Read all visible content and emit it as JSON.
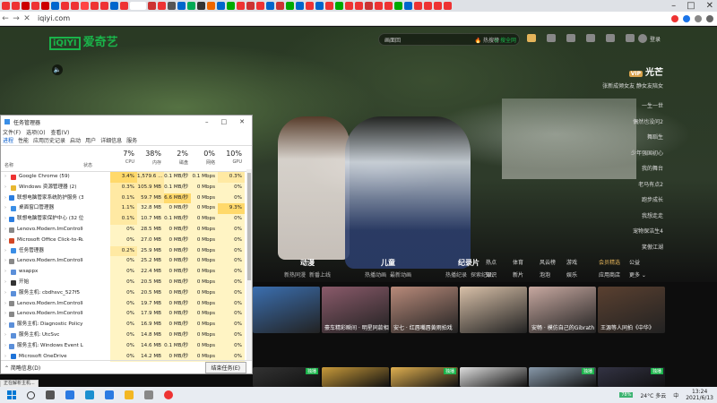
{
  "browser": {
    "url": "iqiyi.com",
    "tab_colors": [
      "#e33",
      "#e33",
      "#c00",
      "#e33",
      "#c00",
      "#06c",
      "#e33",
      "#e33",
      "#f44",
      "#e33",
      "#e33",
      "#06c",
      "#e33",
      "#fff",
      "#c33",
      "#e33",
      "#555",
      "#06c",
      "#0a5",
      "#333",
      "#e60",
      "#06c",
      "#0a0",
      "#e33",
      "#c33",
      "#e33",
      "#06c",
      "#c33",
      "#0a0",
      "#06c",
      "#e33",
      "#06c",
      "#e33",
      "#0a0",
      "#e33",
      "#e33",
      "#c33",
      "#e33",
      "#e33",
      "#0a0",
      "#06c",
      "#e33",
      "#e33",
      "#e33",
      "#e33"
    ],
    "window_controls": [
      "–",
      "□",
      "✕"
    ]
  },
  "site": {
    "logo_text": "爱奇艺",
    "logo_box": "iQIYI",
    "search_placeholder": "画面回",
    "search_hot": "🔥 热搜榜",
    "search_button": "⊙ 搜全网",
    "login_label": "登录",
    "hero": {
      "vip": "VIP",
      "title": "光芒",
      "subtitle": "张新成倾女友 静女友陪女",
      "items": [
        "一生一世",
        "偶然也没问2",
        "舞蹈生",
        "少年强国初心",
        "我的舞台",
        "老马有点2",
        "跑步成长",
        "我想走走",
        "宠物保洁生4",
        "笑傲江湖"
      ]
    },
    "channels": [
      {
        "label": "动漫",
        "subs": [
          "新热同漫",
          "新番上线"
        ]
      },
      {
        "label": "儿童",
        "subs": [
          "热播动画",
          "最新动画"
        ]
      },
      {
        "label": "纪录片",
        "subs": [
          "热播纪录",
          "探索纪录"
        ]
      }
    ],
    "channel_grid": [
      "热点",
      "体育",
      "风云榜",
      "游戏",
      "知识",
      "新片",
      "泡泡",
      "娱乐"
    ],
    "channel_grid2": [
      "会员精选",
      "公益",
      "应用商店",
      "更多 ⌄"
    ],
    "row1_captions": [
      "",
      "豪车精彩瞬间 · 明星同款相",
      "安七 · 红唇嘴唇黄雨拍戏",
      "",
      "安畅 · 模仿自己的Gibrath",
      "王源等人同拍《中华》"
    ],
    "row1_colors": [
      "#3b6fb0",
      "#8a5a6a",
      "#b88a7a",
      "#d8c0a8",
      "#c7a8a0",
      "#5a4030"
    ],
    "row2_tags": [
      "独播",
      "",
      "独播",
      "",
      "独播",
      "独播"
    ],
    "row2_colors": [
      "#333",
      "#c89a3a",
      "#e0b050",
      "#ddd",
      "#8899aa",
      "#334"
    ]
  },
  "task_manager": {
    "title": "任务管理器",
    "menu": [
      "文件(F)",
      "选项(O)",
      "查看(V)"
    ],
    "tabs": [
      "进程",
      "性能",
      "应用历史记录",
      "启动",
      "用户",
      "详细信息",
      "服务"
    ],
    "columns": {
      "name": "名称",
      "status": "状态",
      "cpu": {
        "pct": "7%",
        "label": "CPU"
      },
      "mem": {
        "pct": "38%",
        "label": "内存"
      },
      "disk": {
        "pct": "2%",
        "label": "磁盘"
      },
      "net": {
        "pct": "0%",
        "label": "网络"
      },
      "gpu": {
        "pct": "10%",
        "label": "GPU"
      }
    },
    "rows": [
      {
        "name": "Google Chrome (59)",
        "cpu": "3.4%",
        "mem": "1,579.6 ...",
        "disk": "0.1 MB/秒",
        "net": "0.1 Mbps",
        "gpu": "0.3%",
        "icon": "#e33"
      },
      {
        "name": "Windows 资源管理器 (2)",
        "cpu": "0.3%",
        "mem": "105.9 MB",
        "disk": "0.1 MB/秒",
        "net": "0 Mbps",
        "gpu": "0%",
        "icon": "#e8b730"
      },
      {
        "name": "联想电脑管家系统防护服务 (32...",
        "cpu": "0.1%",
        "mem": "59.7 MB",
        "disk": "6.6 MB/秒",
        "net": "0 Mbps",
        "gpu": "0%",
        "icon": "#2b7de0"
      },
      {
        "name": "桌面窗口管理器",
        "cpu": "1.1%",
        "mem": "32.8 MB",
        "disk": "0 MB/秒",
        "net": "0 Mbps",
        "gpu": "9.3%",
        "icon": "#3a8ee6"
      },
      {
        "name": "联想电脑管家保护中心 (32 位)",
        "cpu": "0.1%",
        "mem": "10.7 MB",
        "disk": "0.1 MB/秒",
        "net": "0 Mbps",
        "gpu": "0%",
        "icon": "#2b7de0"
      },
      {
        "name": "Lenovo.Modern.ImControlle...",
        "cpu": "0%",
        "mem": "28.5 MB",
        "disk": "0 MB/秒",
        "net": "0 Mbps",
        "gpu": "0%",
        "icon": "#888"
      },
      {
        "name": "Microsoft Office Click-to-Ru...",
        "cpu": "0%",
        "mem": "27.0 MB",
        "disk": "0 MB/秒",
        "net": "0 Mbps",
        "gpu": "0%",
        "icon": "#d24726"
      },
      {
        "name": "任务管理器",
        "cpu": "0.2%",
        "mem": "25.9 MB",
        "disk": "0 MB/秒",
        "net": "0 Mbps",
        "gpu": "0%",
        "icon": "#3a8ee6"
      },
      {
        "name": "Lenovo.Modern.ImControlle...",
        "cpu": "0%",
        "mem": "25.2 MB",
        "disk": "0 MB/秒",
        "net": "0 Mbps",
        "gpu": "0%",
        "icon": "#888"
      },
      {
        "name": "wsappx",
        "cpu": "0%",
        "mem": "22.4 MB",
        "disk": "0 MB/秒",
        "net": "0 Mbps",
        "gpu": "0%",
        "icon": "#5b8fd9"
      },
      {
        "name": "开始",
        "cpu": "0%",
        "mem": "20.5 MB",
        "disk": "0 MB/秒",
        "net": "0 Mbps",
        "gpu": "0%",
        "icon": "#333"
      },
      {
        "name": "服务主机: cbdhsvc_527f5",
        "cpu": "0%",
        "mem": "20.5 MB",
        "disk": "0 MB/秒",
        "net": "0 Mbps",
        "gpu": "0%",
        "icon": "#5b8fd9"
      },
      {
        "name": "Lenovo.Modern.ImControlle...",
        "cpu": "0%",
        "mem": "19.7 MB",
        "disk": "0 MB/秒",
        "net": "0 Mbps",
        "gpu": "0%",
        "icon": "#888"
      },
      {
        "name": "Lenovo.Modern.ImControlle...",
        "cpu": "0%",
        "mem": "17.9 MB",
        "disk": "0 MB/秒",
        "net": "0 Mbps",
        "gpu": "0%",
        "icon": "#888"
      },
      {
        "name": "服务主机: Diagnostic Policy S...",
        "cpu": "0%",
        "mem": "16.9 MB",
        "disk": "0 MB/秒",
        "net": "0 Mbps",
        "gpu": "0%",
        "icon": "#5b8fd9"
      },
      {
        "name": "服务主机: UtcSvc",
        "cpu": "0%",
        "mem": "14.8 MB",
        "disk": "0 MB/秒",
        "net": "0 Mbps",
        "gpu": "0%",
        "icon": "#5b8fd9"
      },
      {
        "name": "服务主机: Windows Event Log",
        "cpu": "0%",
        "mem": "14.6 MB",
        "disk": "0.1 MB/秒",
        "net": "0 Mbps",
        "gpu": "0%",
        "icon": "#5b8fd9"
      },
      {
        "name": "Microsoft OneDrive",
        "cpu": "0%",
        "mem": "14.2 MB",
        "disk": "0 MB/秒",
        "net": "0 Mbps",
        "gpu": "0%",
        "icon": "#1e73d8"
      }
    ],
    "fewer_details": "⌃ 简略信息(D)",
    "end_task": "结束任务(E)"
  },
  "statusbar": "正在解析主机...",
  "taskbar": {
    "icon_colors": [
      "#555",
      "#2a7ae2",
      "#1a8fd0",
      "#2a7ae2",
      "#f3b723",
      "#888",
      "#e33"
    ],
    "battery": "78%",
    "temp": "24°C 多云",
    "ime": "中",
    "time": "13:24",
    "date": "2021/6/13"
  }
}
